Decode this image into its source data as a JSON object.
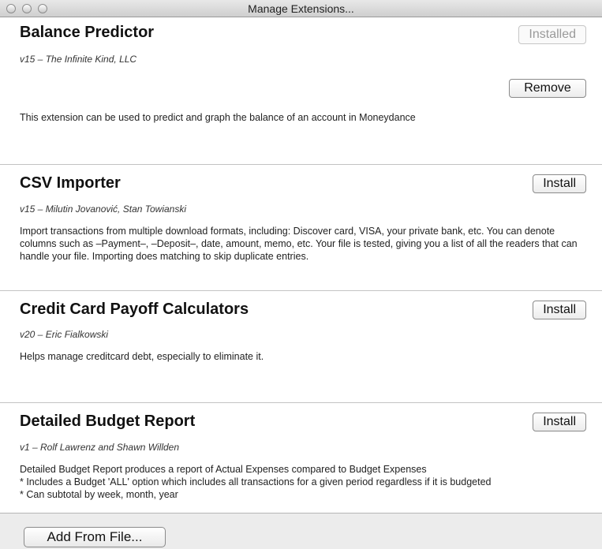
{
  "window": {
    "title": "Manage Extensions..."
  },
  "extensions": [
    {
      "name": "Balance Predictor",
      "meta": "v15 – The Infinite Kind, LLC",
      "status_label": "Installed",
      "action_label": "Remove",
      "description": "This extension can be used to predict and graph the balance of an account in Moneydance"
    },
    {
      "name": "CSV Importer",
      "meta": "v15 – Milutin Jovanović, Stan Towianski",
      "action_label": "Install",
      "description": "Import transactions from multiple download formats, including: Discover card, VISA, your private bank, etc. You can denote columns such as –Payment–, –Deposit–, date, amount, memo, etc.  Your file is tested, giving you a list of all the readers that can handle your file.  Importing does matching to skip duplicate entries."
    },
    {
      "name": "Credit Card Payoff Calculators",
      "meta": "v20 – Eric Fialkowski",
      "action_label": "Install",
      "description": "Helps manage creditcard debt, especially to eliminate it."
    },
    {
      "name": "Detailed Budget Report",
      "meta": "v1 – Rolf Lawrenz and Shawn Willden",
      "action_label": "Install",
      "description_lines": [
        "Detailed Budget Report produces a report of Actual Expenses compared to Budget Expenses",
        "* Includes a Budget 'ALL' option which includes all transactions for a given period regardless if it is budgeted",
        "* Can subtotal by week, month, year"
      ]
    }
  ],
  "footer": {
    "add_from_file_label": "Add From File..."
  }
}
